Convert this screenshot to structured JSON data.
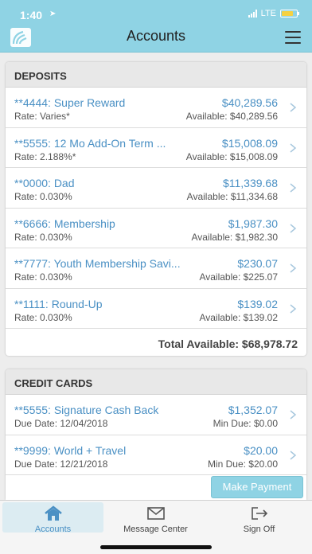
{
  "status": {
    "time": "1:40",
    "carrier": "LTE"
  },
  "nav": {
    "title": "Accounts",
    "logo_icon": "signal-wave-logo",
    "menu_icon": "hamburger-menu-icon"
  },
  "deposits": {
    "header": "DEPOSITS",
    "rows": [
      {
        "name": "**4444: Super Reward",
        "amount": "$40,289.56",
        "rate": "Rate: Varies*",
        "available": "Available: $40,289.56"
      },
      {
        "name": "**5555: 12 Mo Add-On Term ...",
        "amount": "$15,008.09",
        "rate": "Rate: 2.188%*",
        "available": "Available: $15,008.09"
      },
      {
        "name": "**0000: Dad",
        "amount": "$11,339.68",
        "rate": "Rate: 0.030%",
        "available": "Available: $11,334.68"
      },
      {
        "name": "**6666: Membership",
        "amount": "$1,987.30",
        "rate": "Rate: 0.030%",
        "available": "Available: $1,982.30"
      },
      {
        "name": "**7777: Youth Membership Savi...",
        "amount": "$230.07",
        "rate": "Rate: 0.030%",
        "available": "Available: $225.07"
      },
      {
        "name": "**1111: Round-Up",
        "amount": "$139.02",
        "rate": "Rate: 0.030%",
        "available": "Available: $139.02"
      }
    ],
    "total": "Total Available: $68,978.72"
  },
  "credit_cards": {
    "header": "CREDIT CARDS",
    "rows": [
      {
        "name": "**5555: Signature Cash Back",
        "amount": "$1,352.07",
        "due_date": "Due Date: 12/04/2018",
        "min_due": "Min Due: $0.00"
      },
      {
        "name": "**9999: World + Travel",
        "amount": "$20.00",
        "due_date": "Due Date: 12/21/2018",
        "min_due": "Min Due: $20.00"
      }
    ],
    "make_payment": "Make Payment"
  },
  "tabs": [
    {
      "label": "Accounts",
      "icon": "home-icon"
    },
    {
      "label": "Message Center",
      "icon": "envelope-icon"
    },
    {
      "label": "Sign Off",
      "icon": "sign-out-icon"
    }
  ],
  "colors": {
    "accent": "#8fd3e4",
    "link": "#4a90c4",
    "battery": "#f5d142"
  }
}
